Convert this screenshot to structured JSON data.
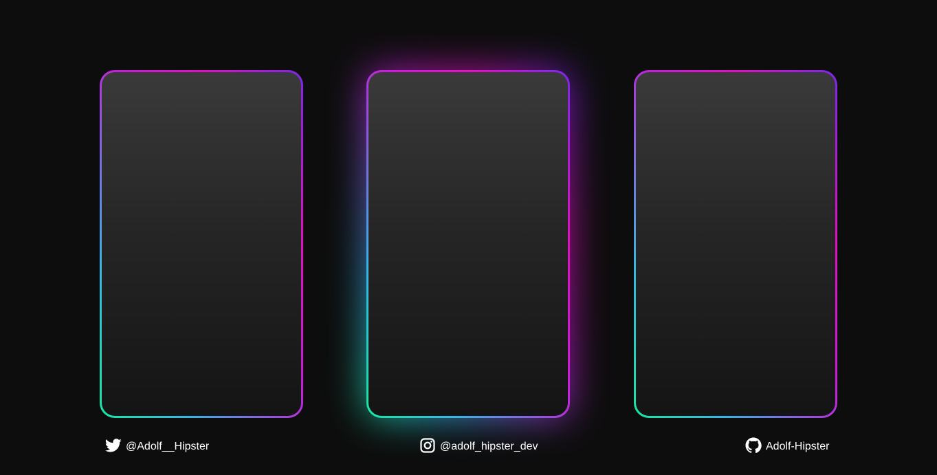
{
  "cards": [
    {
      "id": "left",
      "glowing": false
    },
    {
      "id": "center",
      "glowing": true
    },
    {
      "id": "right",
      "glowing": false
    }
  ],
  "colors": {
    "background": "#0d0d0d",
    "border_gradient": [
      "#18e6a0",
      "#38b6e6",
      "#c81cd8",
      "#e010c0",
      "#7a28e8"
    ],
    "card_fill_top": "#3a3a3a",
    "card_fill_bottom": "#141414",
    "text": "#ffffff"
  },
  "social": {
    "twitter": {
      "icon": "twitter-icon",
      "handle": "@Adolf__Hipster"
    },
    "instagram": {
      "icon": "instagram-icon",
      "handle": "@adolf_hipster_dev"
    },
    "github": {
      "icon": "github-icon",
      "handle": "Adolf-Hipster"
    }
  }
}
